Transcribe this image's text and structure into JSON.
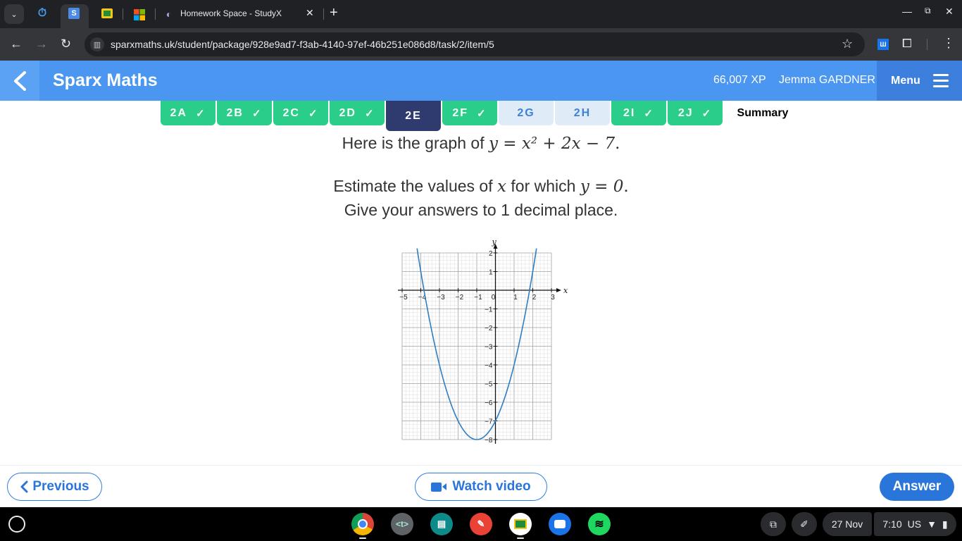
{
  "browser": {
    "tabs": [
      {
        "title": "Homework Space - StudyX",
        "icon": "studyx-icon"
      }
    ],
    "pinned_icons": [
      "timer-icon",
      "sparx-s-icon",
      "google-classroom-icon",
      "microsoft-icon"
    ],
    "url": "sparxmaths.uk/student/package/928e9ad7-f3ab-4140-97ef-46b251e086d8/task/2/item/5",
    "new_tab_label": "+",
    "close_tab_label": "✕"
  },
  "header": {
    "brand": "Sparx Maths",
    "xp": "66,007 XP",
    "user": "Jemma GARDNER",
    "menu_label": "Menu"
  },
  "task_tabs": [
    {
      "label": "2A",
      "status": "done"
    },
    {
      "label": "2B",
      "status": "done"
    },
    {
      "label": "2C",
      "status": "done"
    },
    {
      "label": "2D",
      "status": "done"
    },
    {
      "label": "2E",
      "status": "current"
    },
    {
      "label": "2F",
      "status": "done"
    },
    {
      "label": "2G",
      "status": "todo"
    },
    {
      "label": "2H",
      "status": "todo"
    },
    {
      "label": "2I",
      "status": "done"
    },
    {
      "label": "2J",
      "status": "done"
    },
    {
      "label": "Summary",
      "status": "summary"
    }
  ],
  "question": {
    "line1_text": "Here is the graph of ",
    "line1_eq": "y = x² + 2x − 7",
    "line1_end": ".",
    "line2_text": "Estimate the values of ",
    "line2_var": "x",
    "line2_mid": " for which ",
    "line2_eq": "y = 0",
    "line2_end": ".",
    "line3": "Give your answers to 1 decimal place."
  },
  "chart_data": {
    "type": "line",
    "function": "y = x^2 + 2x - 7",
    "series": [
      {
        "name": "y = x^2 + 2x - 7",
        "color": "#2e7ec4",
        "x": [
          -4.2,
          -4,
          -3.5,
          -3,
          -2.5,
          -2,
          -1.5,
          -1,
          -0.5,
          0,
          0.5,
          1,
          1.5,
          2,
          2.2
        ],
        "y": [
          1.24,
          1,
          -1.75,
          -4,
          -5.75,
          -7,
          -7.75,
          -8,
          -7.75,
          -7,
          -5.75,
          -4,
          -1.75,
          1,
          1.24
        ]
      }
    ],
    "xlabel": "x",
    "ylabel": "y",
    "xlim": [
      -5,
      3
    ],
    "ylim": [
      -8,
      2
    ],
    "xticks": [
      "-5",
      "-4",
      "-3",
      "-2",
      "-1",
      "0",
      "1",
      "2",
      "3"
    ],
    "yticks": [
      "2",
      "1",
      "-1",
      "-2",
      "-3",
      "-4",
      "-5",
      "-6",
      "-7",
      "-8"
    ],
    "grid": true,
    "minor_grid_per_unit": 5
  },
  "footer": {
    "previous_label": "Previous",
    "video_label": "Watch video",
    "answer_label": "Answer"
  },
  "shelf": {
    "apps": [
      "chrome-icon",
      "text-editor-icon",
      "screencast-icon",
      "canvas-icon",
      "google-classroom-icon",
      "camera-icon",
      "spotify-icon"
    ],
    "date": "27 Nov",
    "time": "7:10",
    "locale": "US"
  }
}
